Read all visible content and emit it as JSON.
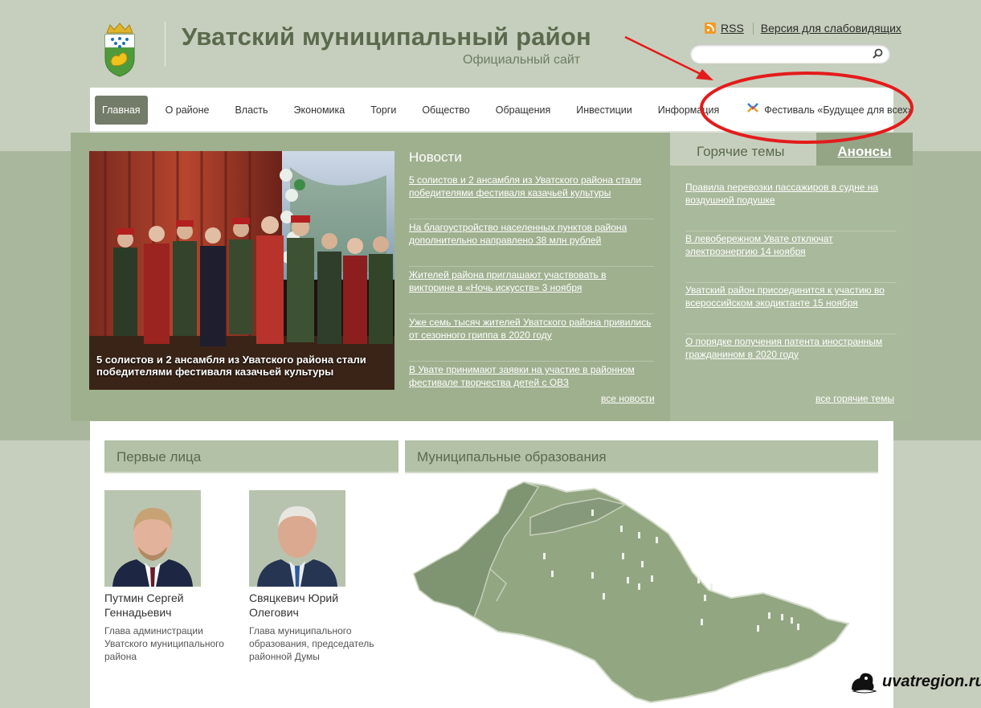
{
  "header": {
    "title": "Уватский муниципальный район",
    "subtitle": "Официальный сайт",
    "rss_label": "RSS",
    "accessible_label": "Версия для слабовидящих"
  },
  "search": {
    "value": "",
    "placeholder": ""
  },
  "nav": {
    "items": [
      "Главная",
      "О районе",
      "Власть",
      "Экономика",
      "Торги",
      "Общество",
      "Обращения",
      "Инвестиции",
      "Информация"
    ],
    "festival": "Фестиваль «Будущее для всех»",
    "active_index": 0
  },
  "feature": {
    "caption": "5 солистов и 2 ансамбля из Уватского района стали победителями фестиваля казачьей культуры"
  },
  "news": {
    "heading": "Новости",
    "items": [
      "5 солистов и 2 ансамбля из Уватского района стали победителями фестиваля казачьей культуры",
      "На благоустройство населенных пунктов района дополнительно направлено 38 млн рублей",
      "Жителей района приглашают участвовать в викторине в «Ночь искусств» 3 ноября",
      "Уже семь тысяч жителей Уватского района привились от сезонного гриппа в 2020 году",
      "В Увате принимают заявки на участие в районном фестивале творчества детей с ОВЗ"
    ],
    "all_link": "все новости"
  },
  "hot": {
    "tab_hot": "Горячие темы",
    "tab_announce": "Анонсы",
    "items": [
      "Правила перевозки пассажиров в судне на воздушной подушке",
      "В левобережном Увате отключат электроэнергию 14 ноября",
      "Уватский район присоединится к участию во всероссийском экодиктанте 15 ноября",
      "О порядке получения патента иностранным гражданином в 2020 году"
    ],
    "all_link": "все горячие темы"
  },
  "people": {
    "heading": "Первые лица",
    "list": [
      {
        "name": "Путмин Сергей Геннадьевич",
        "role": "Глава администрации Уватского муниципального района"
      },
      {
        "name": "Свяцкевич Юрий Олегович",
        "role": "Глава муниципального образования, председатель районной Думы"
      }
    ]
  },
  "municipal": {
    "heading": "Муниципальные образования"
  },
  "watermark": "uvatregion.ru",
  "colors": {
    "background": "#c6cfbd",
    "panel_green": "#9fb08f",
    "nav_active": "#737c69",
    "title_green": "#5b6a4c",
    "annotation_red": "#e41b1b",
    "rss_orange": "#f29a28"
  }
}
